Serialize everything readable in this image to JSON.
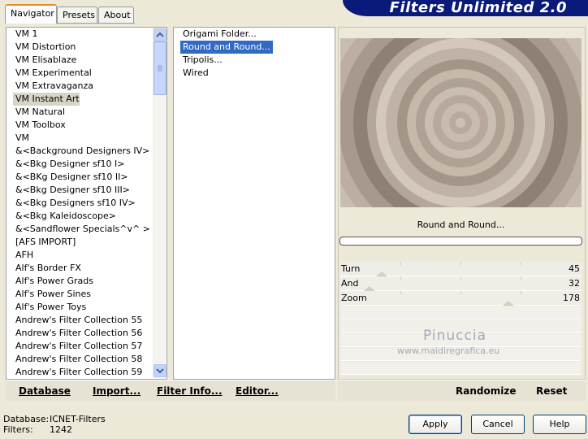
{
  "tabs": [
    {
      "label": "Navigator"
    },
    {
      "label": "Presets"
    },
    {
      "label": "About"
    }
  ],
  "banner": {
    "title": "Filters Unlimited 2.0",
    "color": "#0a1a7a"
  },
  "categories": [
    "VM 1",
    "VM Distortion",
    "VM Elisablaze",
    "VM Experimental",
    "VM Extravaganza",
    "VM Instant Art",
    "VM Natural",
    "VM Toolbox",
    "VM",
    "&<Background Designers IV>",
    "&<Bkg Designer sf10 I>",
    "&<BKg Designer sf10 II>",
    "&<Bkg Designer sf10 III>",
    "&<Bkg Designers sf10 IV>",
    "&<Bkg Kaleidoscope>",
    "&<Sandflower Specials^v^ >",
    "[AFS IMPORT]",
    "AFH",
    "Alf's Border FX",
    "Alf's Power Grads",
    "Alf's Power Sines",
    "Alf's Power Toys",
    "Andrew's Filter Collection 55",
    "Andrew's Filter Collection 56",
    "Andrew's Filter Collection 57",
    "Andrew's Filter Collection 58",
    "Andrew's Filter Collection 59"
  ],
  "selected_category": "VM Instant Art",
  "filters": [
    "Origami Folder...",
    "Round and Round...",
    "Tripolis...",
    "Wired"
  ],
  "selected_filter": "Round and Round...",
  "toolbar": {
    "database": "Database",
    "import": "Import...",
    "filter_info": "Filter Info...",
    "editor": "Editor...",
    "randomize": "Randomize",
    "reset": "Reset"
  },
  "preview": {
    "filter_name": "Round and Round..."
  },
  "params": [
    {
      "label": "Turn",
      "value": "45",
      "level": 45
    },
    {
      "label": "And",
      "value": "32",
      "level": 32
    },
    {
      "label": "Zoom",
      "value": "178",
      "level": 178
    }
  ],
  "watermark": {
    "name": "Pinuccia",
    "url": "www.maidiregrafica.eu"
  },
  "status": {
    "database_label": "Database:",
    "database_value": "ICNET-Filters",
    "filters_label": "Filters:",
    "filters_value": "1242"
  },
  "buttons": {
    "apply": "Apply",
    "cancel": "Cancel",
    "help": "Help"
  }
}
